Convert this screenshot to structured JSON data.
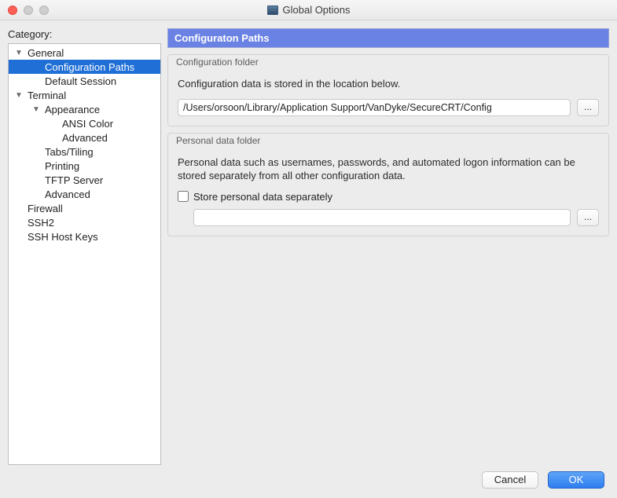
{
  "window": {
    "title": "Global Options"
  },
  "sidebar": {
    "label": "Category:",
    "items": [
      {
        "label": "General",
        "indent": 0,
        "disclosure": "▼",
        "selected": false,
        "key": "general"
      },
      {
        "label": "Configuration Paths",
        "indent": 1,
        "disclosure": "",
        "selected": true,
        "key": "configuration-paths"
      },
      {
        "label": "Default Session",
        "indent": 1,
        "disclosure": "",
        "selected": false,
        "key": "default-session"
      },
      {
        "label": "Terminal",
        "indent": 0,
        "disclosure": "▼",
        "selected": false,
        "key": "terminal"
      },
      {
        "label": "Appearance",
        "indent": 1,
        "disclosure": "▼",
        "selected": false,
        "key": "appearance"
      },
      {
        "label": "ANSI Color",
        "indent": 2,
        "disclosure": "",
        "selected": false,
        "key": "ansi-color"
      },
      {
        "label": "Advanced",
        "indent": 2,
        "disclosure": "",
        "selected": false,
        "key": "appearance-advanced"
      },
      {
        "label": "Tabs/Tiling",
        "indent": 1,
        "disclosure": "",
        "selected": false,
        "key": "tabs-tiling"
      },
      {
        "label": "Printing",
        "indent": 1,
        "disclosure": "",
        "selected": false,
        "key": "printing"
      },
      {
        "label": "TFTP Server",
        "indent": 1,
        "disclosure": "",
        "selected": false,
        "key": "tftp-server"
      },
      {
        "label": "Advanced",
        "indent": 1,
        "disclosure": "",
        "selected": false,
        "key": "terminal-advanced"
      },
      {
        "label": "Firewall",
        "indent": 0,
        "disclosure": "",
        "selected": false,
        "key": "firewall"
      },
      {
        "label": "SSH2",
        "indent": 0,
        "disclosure": "",
        "selected": false,
        "key": "ssh2"
      },
      {
        "label": "SSH Host Keys",
        "indent": 0,
        "disclosure": "",
        "selected": false,
        "key": "ssh-host-keys"
      }
    ]
  },
  "panel": {
    "header": "Configuraton Paths",
    "config_folder": {
      "title": "Configuration folder",
      "desc": "Configuration data is stored in the location below.",
      "path": "/Users/orsoon/Library/Application Support/VanDyke/SecureCRT/Config",
      "browse": "..."
    },
    "personal_folder": {
      "title": "Personal data folder",
      "desc": "Personal data such as usernames, passwords, and automated logon information can be stored separately from all other configuration data.",
      "checkbox_label": "Store personal data separately",
      "path": "",
      "browse": "..."
    }
  },
  "buttons": {
    "cancel": "Cancel",
    "ok": "OK"
  }
}
